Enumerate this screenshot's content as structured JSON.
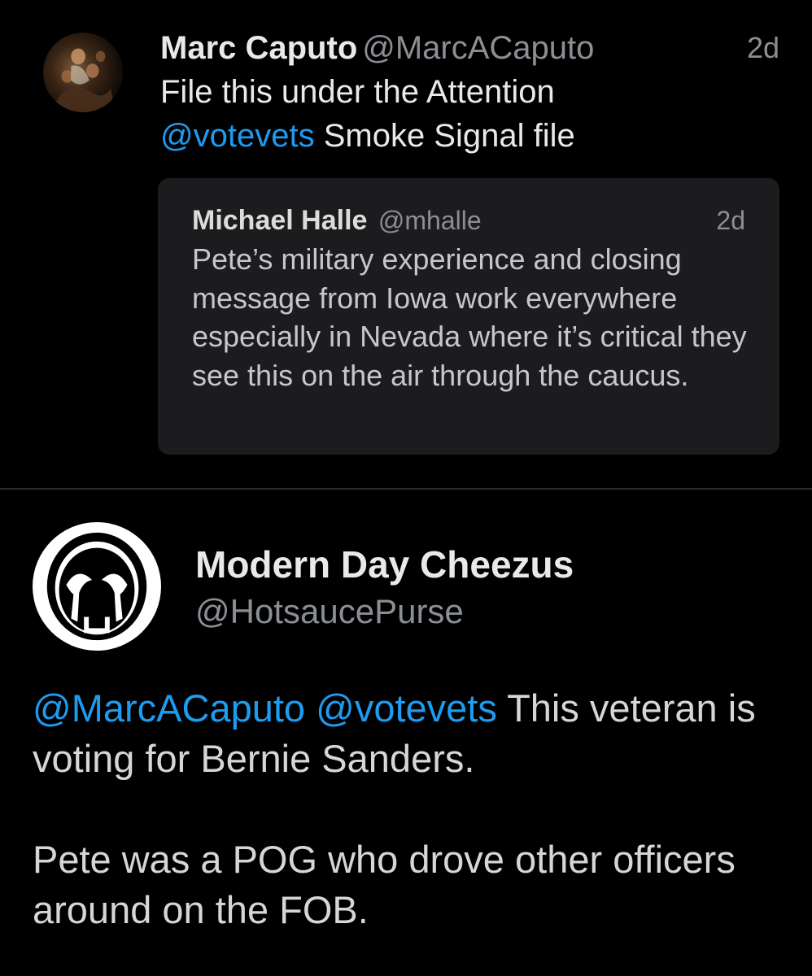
{
  "tweet": {
    "author_name": "Marc Caputo",
    "author_handle": "@MarcACaputo",
    "time": "2d",
    "text_line1": "File this under the Attention",
    "mention": "@votevets",
    "text_after_mention": " Smoke Signal file",
    "avatar_icon": "painting-avatar-icon"
  },
  "quoted_tweet": {
    "author_name": "Michael Halle",
    "author_handle": "@mhalle",
    "time": "2d",
    "text": "Pete’s military experience and closing message from Iowa work everywhere especially in Nevada where it’s critical they see this on the air through the caucus."
  },
  "reply": {
    "author_name": "Modern Day Cheezus",
    "author_handle": "@HotsaucePurse",
    "avatar_icon": "skull-logo-icon",
    "mention1": "@MarcACaputo",
    "mention2": "@votevets",
    "text_line1_rest": " This veteran is voting for Bernie Sanders.",
    "text_paragraph2": "Pete was a POG who drove other officers around on the FOB."
  },
  "colors": {
    "background": "#000000",
    "link": "#1d9bf0",
    "secondary_text": "#8b8f94",
    "quote_background": "#1c1c1e"
  }
}
